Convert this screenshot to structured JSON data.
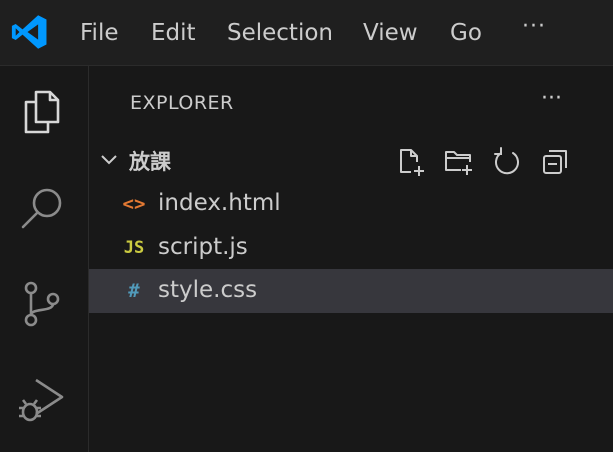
{
  "menu": {
    "items": [
      "File",
      "Edit",
      "Selection",
      "View",
      "Go"
    ],
    "more": "···"
  },
  "explorer": {
    "title": "EXPLORER",
    "more": "···",
    "folder": {
      "name": "放課",
      "expanded": true
    },
    "files": [
      {
        "name": "index.html",
        "icon": "html-file-icon",
        "glyph": "<>",
        "color": "#e37933",
        "selected": false
      },
      {
        "name": "script.js",
        "icon": "js-file-icon",
        "glyph": "JS",
        "color": "#cbcb41",
        "selected": false
      },
      {
        "name": "style.css",
        "icon": "css-file-icon",
        "glyph": "#",
        "color": "#519aba",
        "selected": true
      }
    ]
  },
  "colors": {
    "accent": "#0098ff",
    "background": "#181818",
    "titlebar": "#1f1f1f",
    "selection": "#37373d"
  }
}
